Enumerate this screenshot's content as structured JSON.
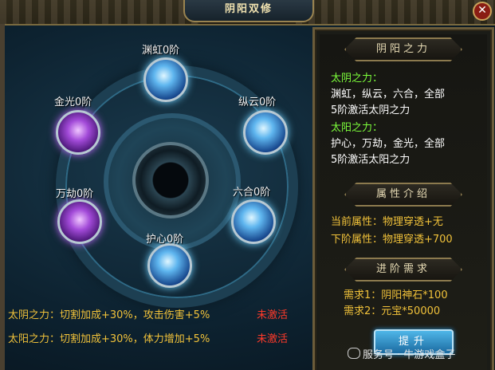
{
  "window": {
    "title": "阴阳双修",
    "close_glyph": "✕"
  },
  "orbs": [
    {
      "id": "yuanhong",
      "label": "渊虹0阶",
      "color": "blue"
    },
    {
      "id": "zongyun",
      "label": "纵云0阶",
      "color": "blue"
    },
    {
      "id": "liuhe",
      "label": "六合0阶",
      "color": "blue"
    },
    {
      "id": "huxin",
      "label": "护心0阶",
      "color": "blue"
    },
    {
      "id": "wanjie",
      "label": "万劫0阶",
      "color": "purple"
    },
    {
      "id": "jinguang",
      "label": "金光0阶",
      "color": "purple"
    }
  ],
  "effects": [
    {
      "text": "太阴之力：切割加成+30%，攻击伤害+5%",
      "status": "未激活"
    },
    {
      "text": "太阳之力：切割加成+30%，体力增加+5%",
      "status": "未激活"
    }
  ],
  "panel": {
    "section1_title": "阴阳之力",
    "taiyin_label": "太阴之力：",
    "taiyin_line1": "渊虹，纵云，六合，全部",
    "taiyin_line2": "5阶激活太阴之力",
    "taiyang_label": "太阳之力：",
    "taiyang_line1": "护心，万劫，金光，全部",
    "taiyang_line2": "5阶激活太阳之力",
    "section2_title": "属性介绍",
    "current_attr": "当前属性：物理穿透+无",
    "next_attr": "下阶属性：物理穿透+700",
    "section3_title": "进阶需求",
    "req1": "需求1：阴阳神石*100",
    "req2": "需求2：元宝*50000",
    "upgrade_button": "提升"
  },
  "watermark": "服务号 · 牛游戏盒子",
  "colors": {
    "gold": "#f1c23a",
    "green": "#7dff3b",
    "red": "#ff3a2a",
    "button": "#2f8fc8"
  }
}
